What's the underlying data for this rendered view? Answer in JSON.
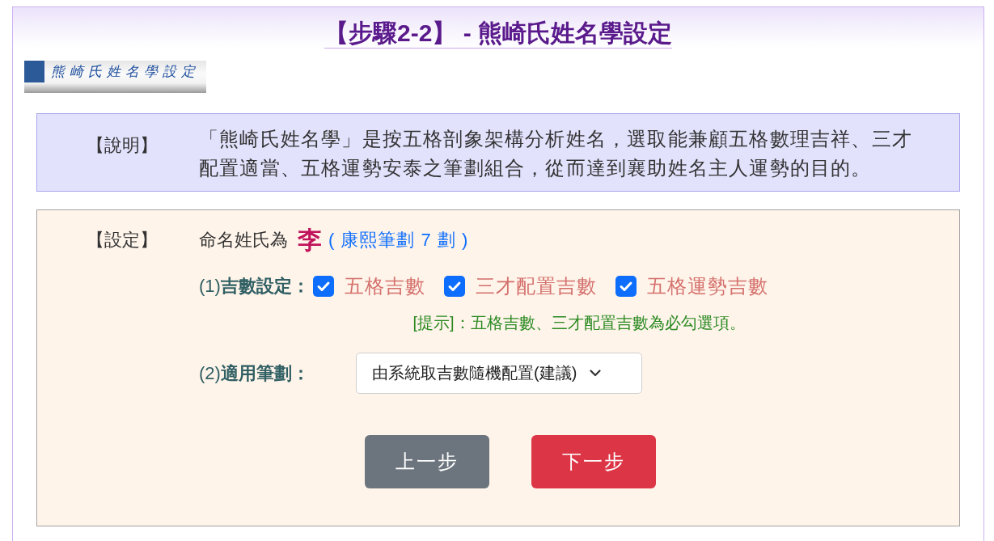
{
  "header": {
    "title": "【步驟2-2】 - 熊崎氏姓名學設定",
    "banner_text": "熊崎氏姓名學設定"
  },
  "description": {
    "label": "【說明】",
    "text": "「熊崎氏姓名學」是按五格剖象架構分析姓名，選取能兼顧五格數理吉祥、三才配置適當、五格運勢安泰之筆劃組合，從而達到襄助姓名主人運勢的目的。"
  },
  "settings": {
    "label": "【設定】",
    "surname_prefix": "命名姓氏為",
    "surname": "李",
    "stroke_note": "( 康熙筆劃 7 劃 )",
    "lucky_numbers": {
      "label": "(1)**吉數設定：**",
      "options": [
        {
          "label": "五格吉數",
          "checked": true
        },
        {
          "label": "三才配置吉數",
          "checked": true
        },
        {
          "label": "五格運勢吉數",
          "checked": true
        }
      ],
      "hint": "[提示]：五格吉數、三才配置吉數為必勾選項。"
    },
    "strokes": {
      "label": "(2)**適用筆劃：**",
      "value": "由系統取吉數隨機配置(建議)"
    }
  },
  "buttons": [
    {
      "label": "上一步",
      "kind": "secondary"
    },
    {
      "label": "下一步",
      "kind": "primary"
    }
  ]
}
